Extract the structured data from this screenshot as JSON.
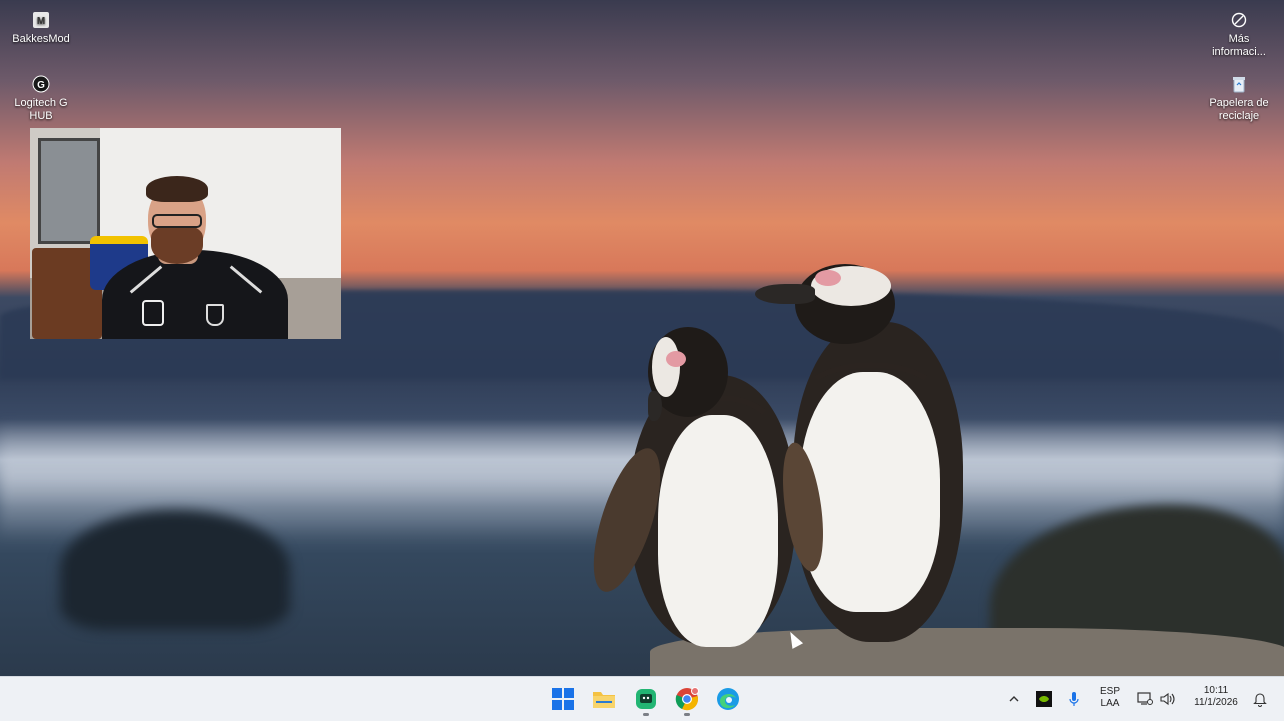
{
  "desktop": {
    "icons_left": [
      {
        "label": "BakkesMod",
        "icon": "bakkesmod-icon"
      },
      {
        "label": "Logitech G HUB",
        "icon": "logitech-ghub-icon"
      }
    ],
    "icons_right": [
      {
        "label": "Más informaci...",
        "icon": "info-icon"
      },
      {
        "label": "Papelera de reciclaje",
        "icon": "recycle-bin-icon"
      }
    ]
  },
  "taskbar": {
    "apps": [
      {
        "name": "start",
        "icon": "windows-start-icon"
      },
      {
        "name": "file-explorer",
        "icon": "folder-icon"
      },
      {
        "name": "chat-app",
        "icon": "chat-app-icon"
      },
      {
        "name": "chrome",
        "icon": "chrome-icon"
      },
      {
        "name": "edge",
        "icon": "edge-icon"
      }
    ],
    "tray": {
      "language_primary": "ESP",
      "language_secondary": "LAA",
      "time": "10:11",
      "date": "11/1/2026"
    }
  },
  "colors": {
    "taskbar_bg": "#eef1f5",
    "windows_blue": "#1a73e8",
    "folder_yellow": "#f4c243",
    "nvidia_green": "#76b900"
  }
}
